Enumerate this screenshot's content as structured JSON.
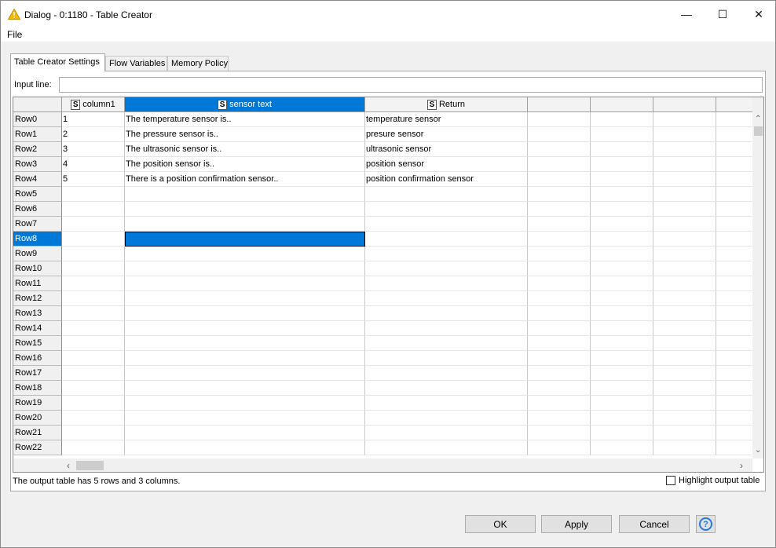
{
  "window": {
    "title": "Dialog - 0:1180 - Table Creator",
    "minimize_glyph": "—",
    "maximize_glyph": "☐",
    "close_glyph": "✕"
  },
  "menu": {
    "file": "File"
  },
  "tabs": [
    {
      "label": "Table Creator Settings",
      "active": true
    },
    {
      "label": "Flow Variables",
      "active": false
    },
    {
      "label": "Memory Policy",
      "active": false
    }
  ],
  "input_line": {
    "label": "Input line:",
    "value": ""
  },
  "table": {
    "columns": [
      {
        "type_icon": "S",
        "name": "column1",
        "selected": false
      },
      {
        "type_icon": "S",
        "name": "sensor text",
        "selected": true
      },
      {
        "type_icon": "S",
        "name": "Return",
        "selected": false
      },
      {
        "type_icon": "",
        "name": "",
        "selected": false
      },
      {
        "type_icon": "",
        "name": "",
        "selected": false
      },
      {
        "type_icon": "",
        "name": "",
        "selected": false
      },
      {
        "type_icon": "",
        "name": "",
        "selected": false
      }
    ],
    "rows": [
      {
        "header": "Row0",
        "cells": [
          "1",
          "The temperature sensor is..",
          "temperature sensor"
        ]
      },
      {
        "header": "Row1",
        "cells": [
          "2",
          "The pressure sensor is..",
          "presure sensor"
        ]
      },
      {
        "header": "Row2",
        "cells": [
          "3",
          "The ultrasonic sensor is..",
          "ultrasonic sensor"
        ]
      },
      {
        "header": "Row3",
        "cells": [
          "4",
          "The position sensor is..",
          "position sensor"
        ]
      },
      {
        "header": "Row4",
        "cells": [
          "5",
          "There is a position confirmation sensor..",
          "position confirmation sensor"
        ]
      },
      {
        "header": "Row5",
        "cells": [
          "",
          "",
          ""
        ]
      },
      {
        "header": "Row6",
        "cells": [
          "",
          "",
          ""
        ]
      },
      {
        "header": "Row7",
        "cells": [
          "",
          "",
          ""
        ]
      },
      {
        "header": "Row8",
        "cells": [
          "",
          "",
          ""
        ],
        "selected": true
      },
      {
        "header": "Row9",
        "cells": [
          "",
          "",
          ""
        ]
      },
      {
        "header": "Row10",
        "cells": [
          "",
          "",
          ""
        ]
      },
      {
        "header": "Row11",
        "cells": [
          "",
          "",
          ""
        ]
      },
      {
        "header": "Row12",
        "cells": [
          "",
          "",
          ""
        ]
      },
      {
        "header": "Row13",
        "cells": [
          "",
          "",
          ""
        ]
      },
      {
        "header": "Row14",
        "cells": [
          "",
          "",
          ""
        ]
      },
      {
        "header": "Row15",
        "cells": [
          "",
          "",
          ""
        ]
      },
      {
        "header": "Row16",
        "cells": [
          "",
          "",
          ""
        ]
      },
      {
        "header": "Row17",
        "cells": [
          "",
          "",
          ""
        ]
      },
      {
        "header": "Row18",
        "cells": [
          "",
          "",
          ""
        ]
      },
      {
        "header": "Row19",
        "cells": [
          "",
          "",
          ""
        ]
      },
      {
        "header": "Row20",
        "cells": [
          "",
          "",
          ""
        ]
      },
      {
        "header": "Row21",
        "cells": [
          "",
          "",
          ""
        ]
      },
      {
        "header": "Row22",
        "cells": [
          "",
          "",
          ""
        ]
      }
    ]
  },
  "scroll": {
    "up": "⌃",
    "down": "⌄",
    "left": "‹",
    "right": "›"
  },
  "status": "The output table has 5 rows and 3 columns.",
  "highlight_label": "Highlight output table",
  "buttons": {
    "ok": "OK",
    "apply": "Apply",
    "cancel": "Cancel",
    "help": "?"
  },
  "colors": {
    "selection": "#0078d7",
    "warning": "#f5b800",
    "help": "#2a7ad4"
  },
  "icons": [
    "warning-icon",
    "help-icon"
  ]
}
